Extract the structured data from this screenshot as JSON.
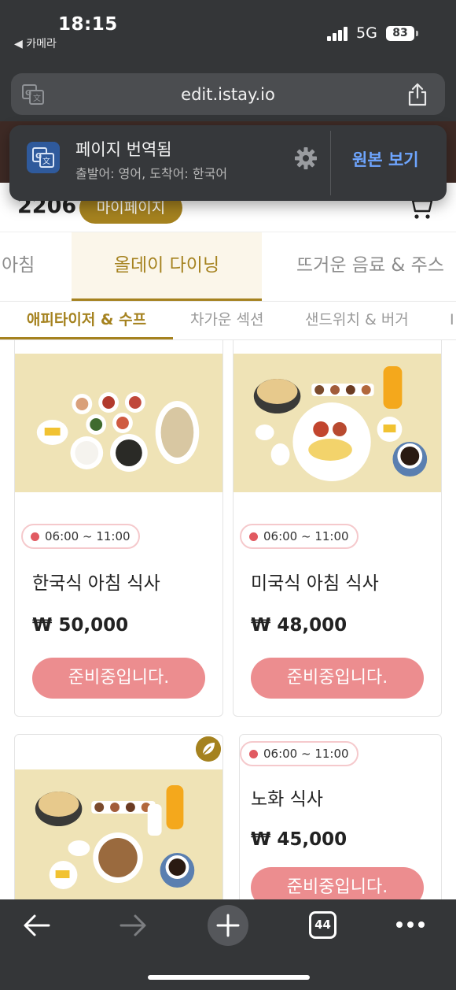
{
  "status": {
    "time": "18:15",
    "back_app": "◀ 카메라",
    "network": "5G",
    "battery": "83"
  },
  "browser": {
    "url": "edit.istay.io"
  },
  "translate": {
    "title": "페이지 번역됨",
    "subtitle": "출발어: 영어, 도착어: 한국어",
    "original_label": "원본 보기"
  },
  "header": {
    "room": "2206",
    "mypage": "마이페이지"
  },
  "categories": [
    {
      "label": "아침",
      "active": false
    },
    {
      "label": "올데이 다이닝",
      "active": true
    },
    {
      "label": "뜨거운 음료 & 주스",
      "active": false
    }
  ],
  "subcategories": [
    {
      "label": "애피타이저 & 수프",
      "active": true
    },
    {
      "label": "차가운 섹션",
      "active": false
    },
    {
      "label": "샌드위치 & 버거",
      "active": false
    }
  ],
  "menu": [
    {
      "hours": "06:00 ~ 11:00",
      "name": "한국식 아침 식사",
      "price": "₩ 50,000",
      "button": "준비중입니다."
    },
    {
      "hours": "06:00 ~ 11:00",
      "name": "미국식 아침 식사",
      "price": "₩ 48,000",
      "button": "준비중입니다."
    },
    {
      "hours": "",
      "name": "",
      "price": "",
      "button": ""
    },
    {
      "hours": "06:00 ~ 11:00",
      "name": "노화 식사",
      "price": "₩ 45,000",
      "button": "준비중입니다."
    }
  ],
  "toolbar": {
    "tabs_count": "44"
  },
  "colors": {
    "accent": "#a5821f",
    "button": "#ec8d8f",
    "dark_chrome": "#343638",
    "brand_brown": "#3e2a25"
  }
}
